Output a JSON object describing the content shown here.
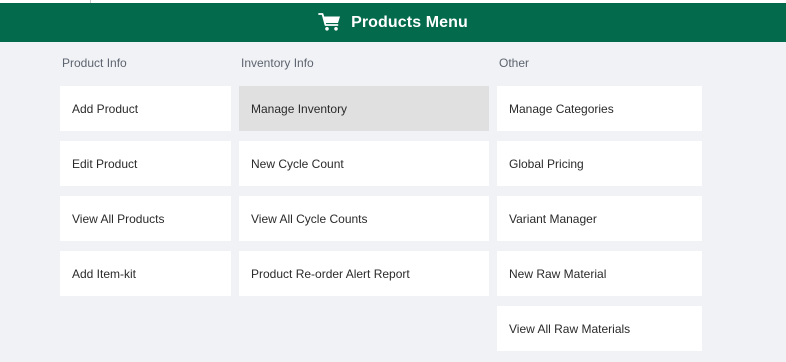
{
  "header": {
    "title": "Products Menu",
    "cart_icon": "shopping-cart-icon",
    "background_color": "#046a4c"
  },
  "columns": [
    {
      "label": "Product Info",
      "items": [
        "Add Product",
        "Edit Product",
        "View All Products",
        "Add Item-kit"
      ]
    },
    {
      "label": "Inventory Info",
      "items": [
        "Manage Inventory",
        "New Cycle Count",
        "View All Cycle Counts",
        "Product Re-order Alert Report"
      ],
      "active_item": "Manage Inventory"
    },
    {
      "label": "Other",
      "items": [
        "Manage Categories",
        "Global Pricing",
        "Variant Manager",
        "New Raw Material",
        "View All Raw Materials"
      ]
    }
  ]
}
